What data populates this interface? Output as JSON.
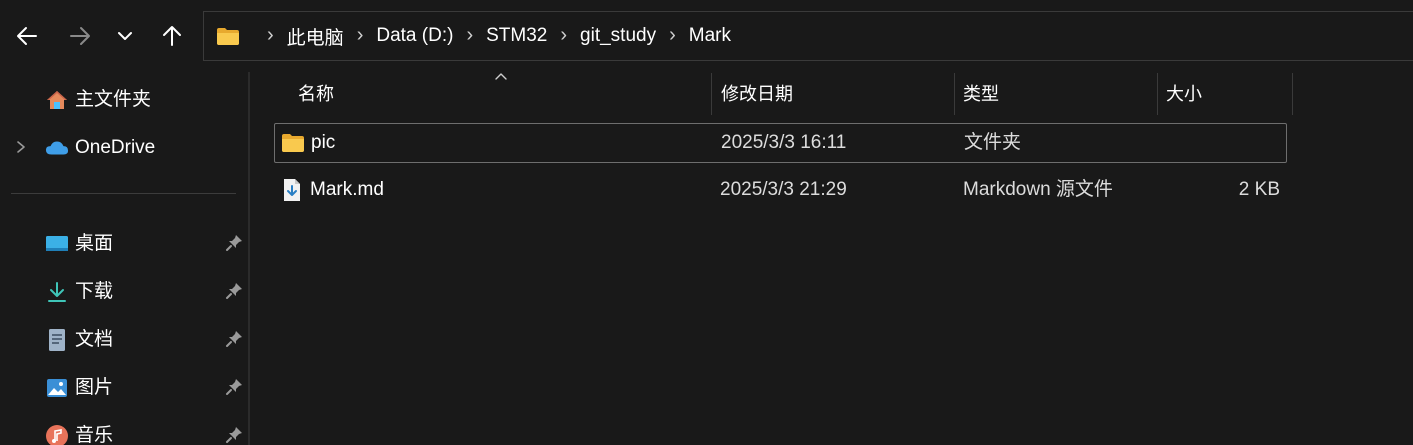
{
  "nav": {
    "back_icon": "arrow-left-icon",
    "forward_icon": "arrow-right-icon",
    "recent_icon": "chevron-down-icon",
    "up_icon": "arrow-up-icon"
  },
  "address": {
    "folder_icon": "folder-icon",
    "crumbs": [
      "此电脑",
      "Data (D:)",
      "STM32",
      "git_study",
      "Mark"
    ],
    "separator": "›"
  },
  "sidebar": {
    "items": [
      {
        "label": "主文件夹",
        "icon": "home-icon",
        "pinned": false,
        "expandable": false
      },
      {
        "label": "OneDrive",
        "icon": "cloud-icon",
        "pinned": false,
        "expandable": true
      },
      {
        "label": "桌面",
        "icon": "desktop-icon",
        "pinned": true,
        "expandable": false
      },
      {
        "label": "下载",
        "icon": "download-icon",
        "pinned": true,
        "expandable": false
      },
      {
        "label": "文档",
        "icon": "document-icon",
        "pinned": true,
        "expandable": false
      },
      {
        "label": "图片",
        "icon": "pictures-icon",
        "pinned": true,
        "expandable": false
      },
      {
        "label": "音乐",
        "icon": "music-icon",
        "pinned": true,
        "expandable": false
      }
    ]
  },
  "columns": {
    "name": "名称",
    "modified": "修改日期",
    "type": "类型",
    "size": "大小",
    "sort_icon": "sort-up-caret-icon"
  },
  "files": [
    {
      "name": "pic",
      "modified": "2025/3/3 16:11",
      "type": "文件夹",
      "size": "",
      "icon": "folder-icon",
      "selected": true
    },
    {
      "name": "Mark.md",
      "modified": "2025/3/3 21:29",
      "type": "Markdown 源文件",
      "size": "2 KB",
      "icon": "markdown-file-icon",
      "selected": false
    }
  ],
  "colors": {
    "background": "#191919",
    "text": "#ffffff",
    "folder": "#f7c54a",
    "accent": "#4cc2ff"
  }
}
